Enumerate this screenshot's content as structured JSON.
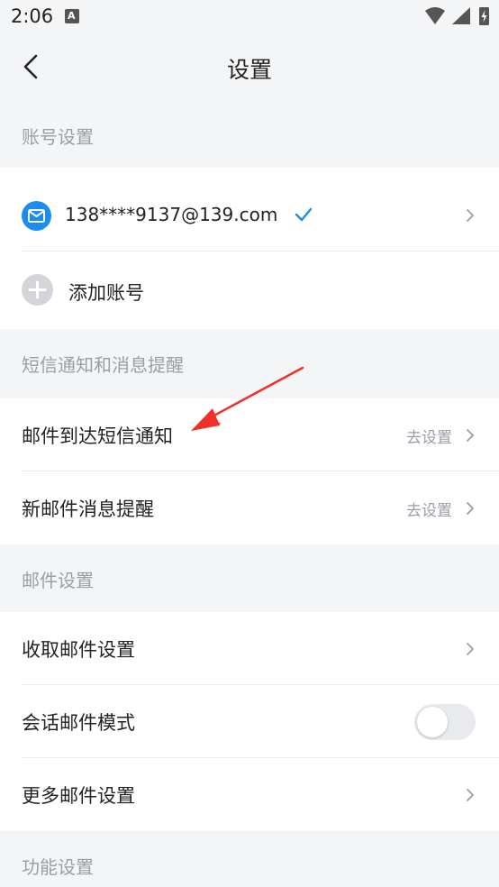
{
  "status_bar": {
    "time": "2:06",
    "notification_letter": "A",
    "icons": [
      "wifi-icon",
      "signal-icon",
      "battery-charging-icon"
    ]
  },
  "app_bar": {
    "title": "设置",
    "back_icon": "chevron-left-icon"
  },
  "sections": {
    "account": {
      "header": "账号设置",
      "account_email": "138****9137@139.com",
      "add_account": "添加账号"
    },
    "sms": {
      "header": "短信通知和消息提醒",
      "arrival_sms": "邮件到达短信通知",
      "arrival_sms_action": "去设置",
      "new_mail_alert": "新邮件消息提醒",
      "new_mail_alert_action": "去设置"
    },
    "mail": {
      "header": "邮件设置",
      "receive": "收取邮件设置",
      "conversation_mode": "会话邮件模式",
      "conversation_mode_on": false,
      "more": "更多邮件设置"
    },
    "features": {
      "header": "功能设置"
    }
  },
  "colors": {
    "accent": "#1b8cf0",
    "annotation_arrow": "#f0302a"
  }
}
